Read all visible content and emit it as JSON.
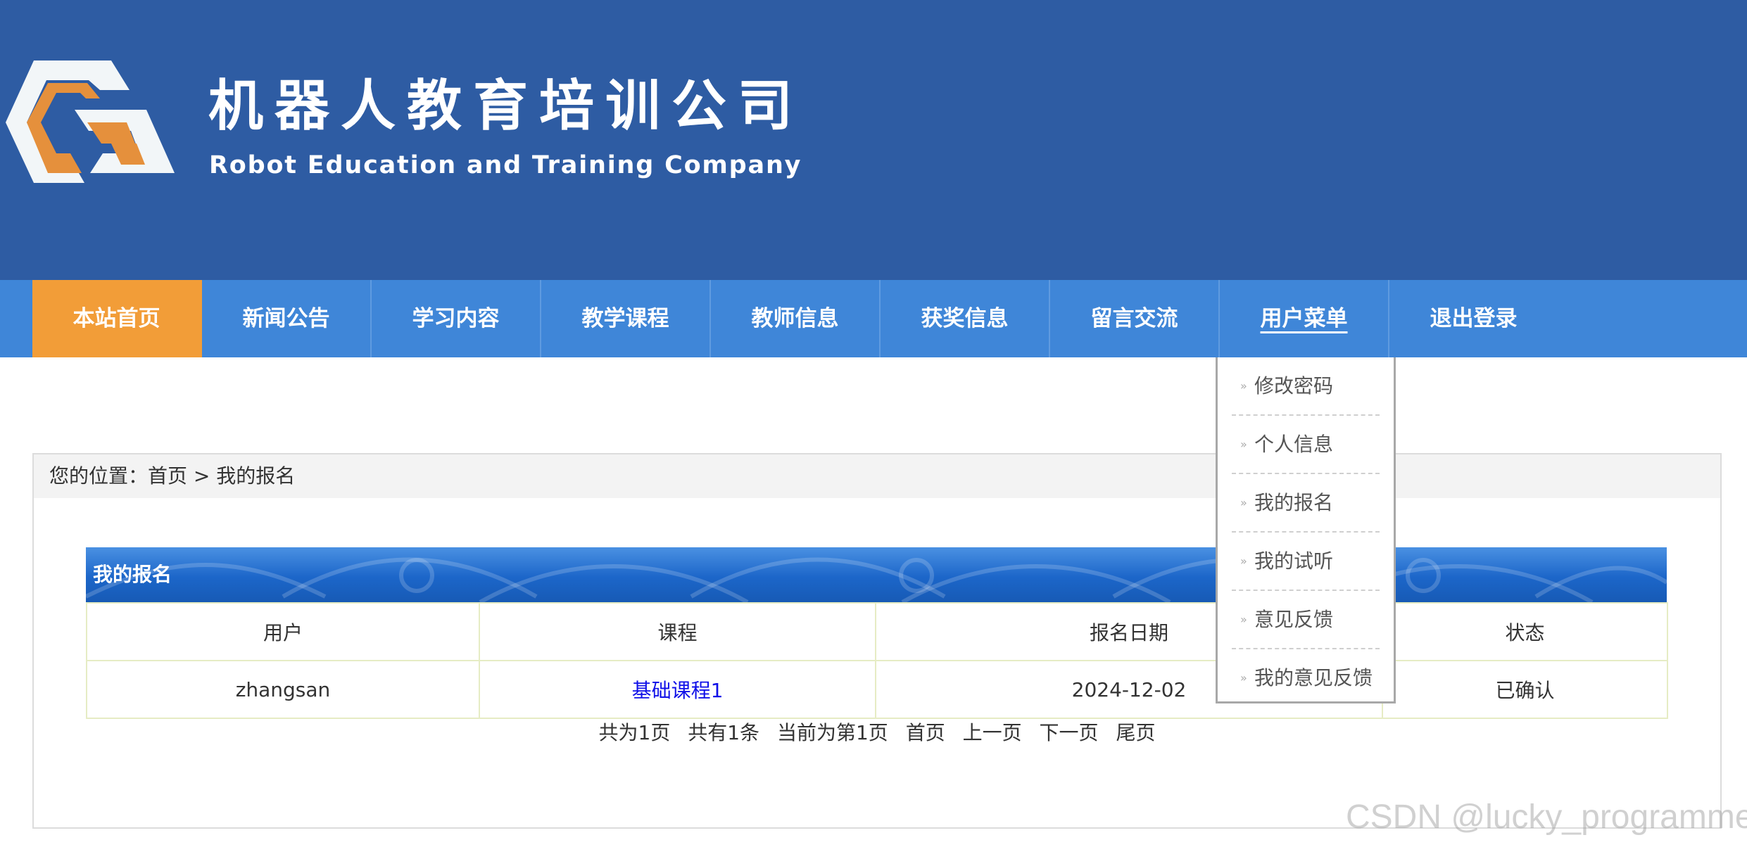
{
  "header": {
    "title": "机器人教育培训公司",
    "subtitle": "Robot Education and Training Company",
    "logo_colors": {
      "orange": "#e5903c",
      "white": "#f2f6f8",
      "background": "#2e5ca3"
    }
  },
  "nav": {
    "items": [
      {
        "label": "本站首页",
        "state": "active"
      },
      {
        "label": "新闻公告"
      },
      {
        "label": "学习内容"
      },
      {
        "label": "教学课程"
      },
      {
        "label": "教师信息"
      },
      {
        "label": "获奖信息"
      },
      {
        "label": "留言交流"
      },
      {
        "label": "用户菜单",
        "state": "hover"
      },
      {
        "label": "退出登录"
      }
    ],
    "accent": "#f29d38",
    "bar_color": "#3f86d8"
  },
  "user_menu": {
    "items": [
      {
        "label": "修改密码"
      },
      {
        "label": "个人信息"
      },
      {
        "label": "我的报名"
      },
      {
        "label": "我的试听"
      },
      {
        "label": "意见反馈"
      },
      {
        "label": "我的意见反馈"
      }
    ],
    "bullet_icon": "double-chevron-right-icon"
  },
  "breadcrumb": {
    "prefix": "您的位置：",
    "home": "首页",
    "separator": " > ",
    "current": "我的报名"
  },
  "panel": {
    "title": "我的报名",
    "columns": [
      "用户",
      "课程",
      "报名日期",
      "状态"
    ],
    "rows": [
      {
        "user": "zhangsan",
        "course": "基础课程1",
        "date": "2024-12-02",
        "status": "已确认"
      }
    ]
  },
  "pager": {
    "total_pages": "共为1页",
    "total_items": "共有1条",
    "current_page": "当前为第1页",
    "first": "首页",
    "prev": "上一页",
    "next": "下一页",
    "last": "尾页"
  },
  "watermark": "CSDN @lucky_programmer"
}
